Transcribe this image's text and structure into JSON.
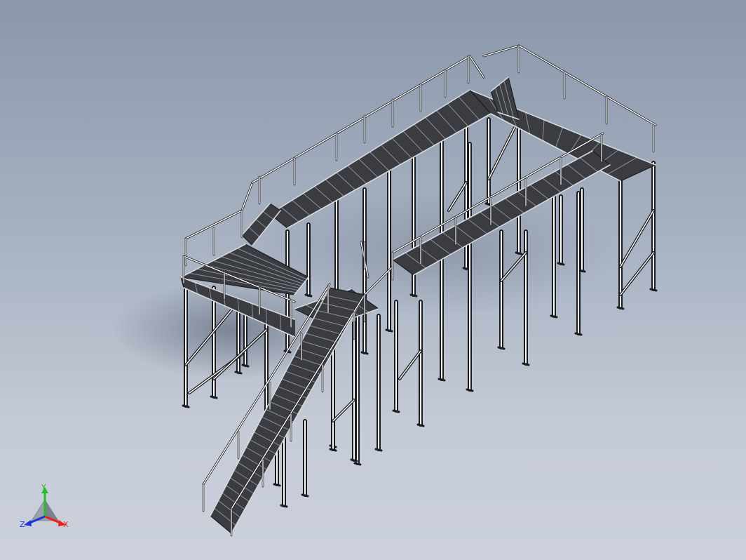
{
  "viewport": {
    "background_top": "#8a97ab",
    "background_bottom": "#ccd1dc"
  },
  "model": {
    "subject": "steel-platform-with-stairs",
    "colors": {
      "steel": "#2f3034",
      "steel_dark": "#1c1d20",
      "highlight": "#ffffff",
      "shadow": "#5e6878"
    }
  },
  "triad": {
    "x_label": "X",
    "y_label": "Y",
    "z_label": "Z",
    "x_color": "#e8201b",
    "y_color": "#1fbf2a",
    "z_color": "#1a36d9"
  }
}
